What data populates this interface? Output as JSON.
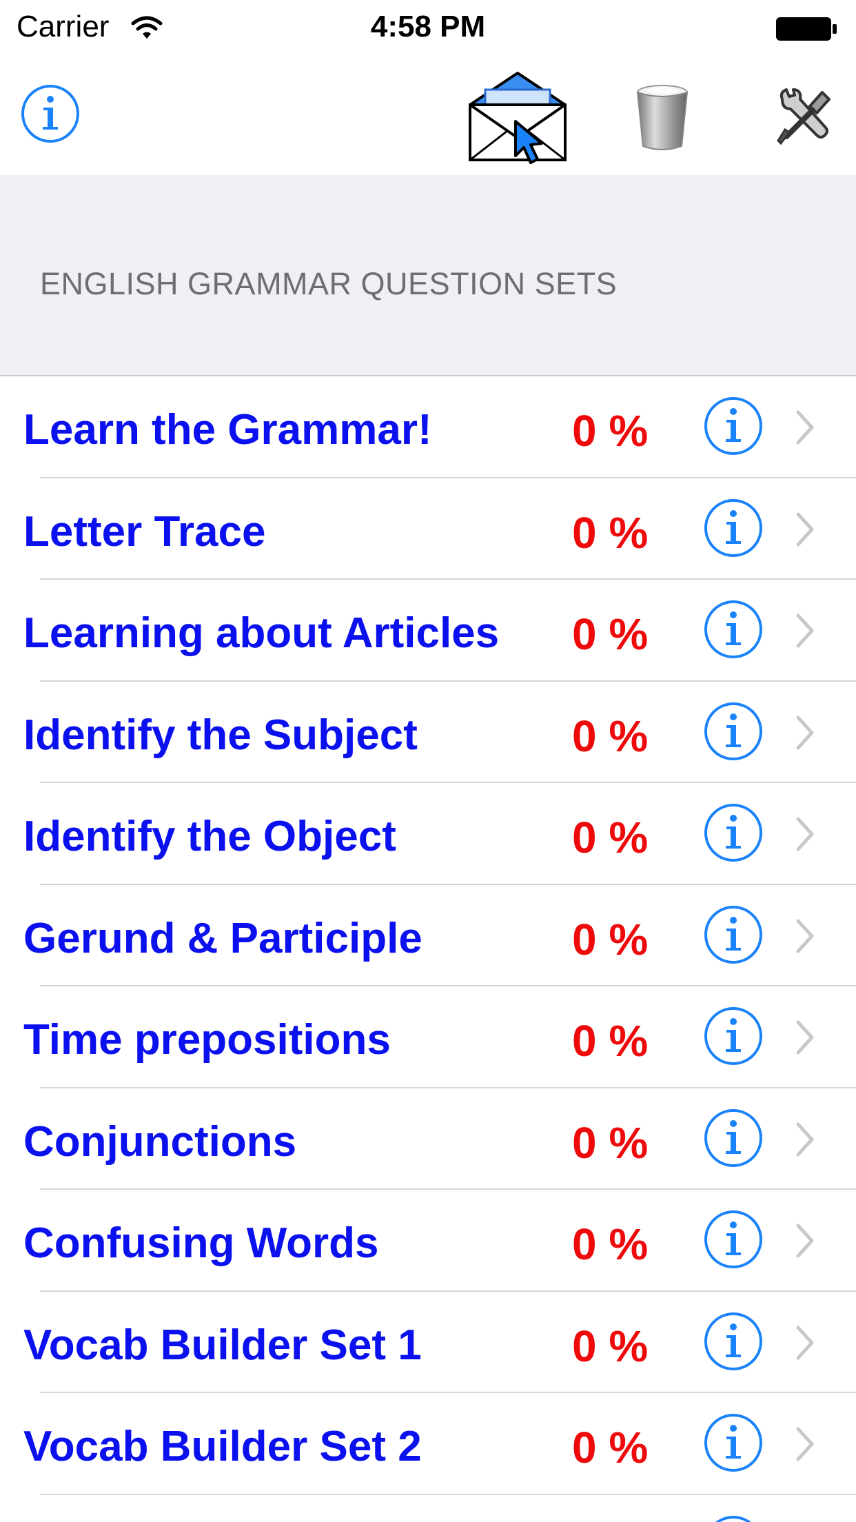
{
  "status_bar": {
    "carrier": "Carrier",
    "time": "4:58 PM"
  },
  "toolbar": {
    "icons": [
      "info-icon",
      "mail-icon",
      "trash-icon",
      "tools-icon"
    ]
  },
  "section": {
    "title": "ENGLISH GRAMMAR QUESTION SETS"
  },
  "rows": [
    {
      "title": "Learn the Grammar!",
      "score": "0 %"
    },
    {
      "title": "Letter Trace",
      "score": "0 %"
    },
    {
      "title": "Learning about Articles",
      "score": "0 %"
    },
    {
      "title": "Identify the Subject",
      "score": "0 %"
    },
    {
      "title": "Identify the Object",
      "score": "0 %"
    },
    {
      "title": "Gerund & Participle",
      "score": "0 %"
    },
    {
      "title": "Time prepositions",
      "score": "0 %"
    },
    {
      "title": "Conjunctions",
      "score": "0 %"
    },
    {
      "title": "Confusing Words",
      "score": "0 %"
    },
    {
      "title": "Vocab Builder Set 1",
      "score": "0 %"
    },
    {
      "title": "Vocab Builder Set 2",
      "score": "0 %"
    },
    {
      "title": "",
      "score": ""
    }
  ],
  "colors": {
    "title_blue": "#0a10ee",
    "score_red": "#ee0a0a",
    "ios_blue": "#1a82fb",
    "header_bg": "#efeff4"
  }
}
